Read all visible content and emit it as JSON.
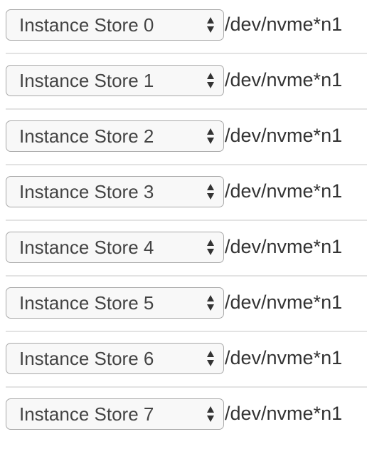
{
  "rows": [
    {
      "select": "Instance Store 0",
      "device": "/dev/nvme*n1"
    },
    {
      "select": "Instance Store 1",
      "device": "/dev/nvme*n1"
    },
    {
      "select": "Instance Store 2",
      "device": "/dev/nvme*n1"
    },
    {
      "select": "Instance Store 3",
      "device": "/dev/nvme*n1"
    },
    {
      "select": "Instance Store 4",
      "device": "/dev/nvme*n1"
    },
    {
      "select": "Instance Store 5",
      "device": "/dev/nvme*n1"
    },
    {
      "select": "Instance Store 6",
      "device": "/dev/nvme*n1"
    },
    {
      "select": "Instance Store 7",
      "device": "/dev/nvme*n1"
    }
  ]
}
